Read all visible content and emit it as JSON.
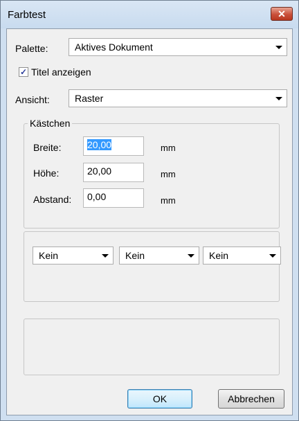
{
  "window": {
    "title": "Farbtest",
    "close_glyph": "✕"
  },
  "palette": {
    "label": "Palette:",
    "value": "Aktives Dokument"
  },
  "show_title": {
    "label": "Titel anzeigen",
    "checked": true
  },
  "view": {
    "label": "Ansicht:",
    "value": "Raster"
  },
  "boxes_group": {
    "legend": "Kästchen",
    "width": {
      "label": "Breite:",
      "value": "20,00",
      "unit": "mm"
    },
    "height": {
      "label": "Höhe:",
      "value": "20,00",
      "unit": "mm"
    },
    "spacing": {
      "label": "Abstand:",
      "value": "0,00",
      "unit": "mm"
    }
  },
  "selectors": [
    {
      "value": "Kein"
    },
    {
      "value": "Kein"
    },
    {
      "value": "Kein"
    }
  ],
  "buttons": {
    "ok": "OK",
    "cancel": "Abbrechen"
  },
  "icons": {
    "dropdown": "chevron-down-icon",
    "close": "close-icon",
    "check": "checkmark-icon"
  },
  "colors": {
    "selection": "#3399ff",
    "titlebar": "#cfdff0",
    "close_button": "#c9503a"
  }
}
